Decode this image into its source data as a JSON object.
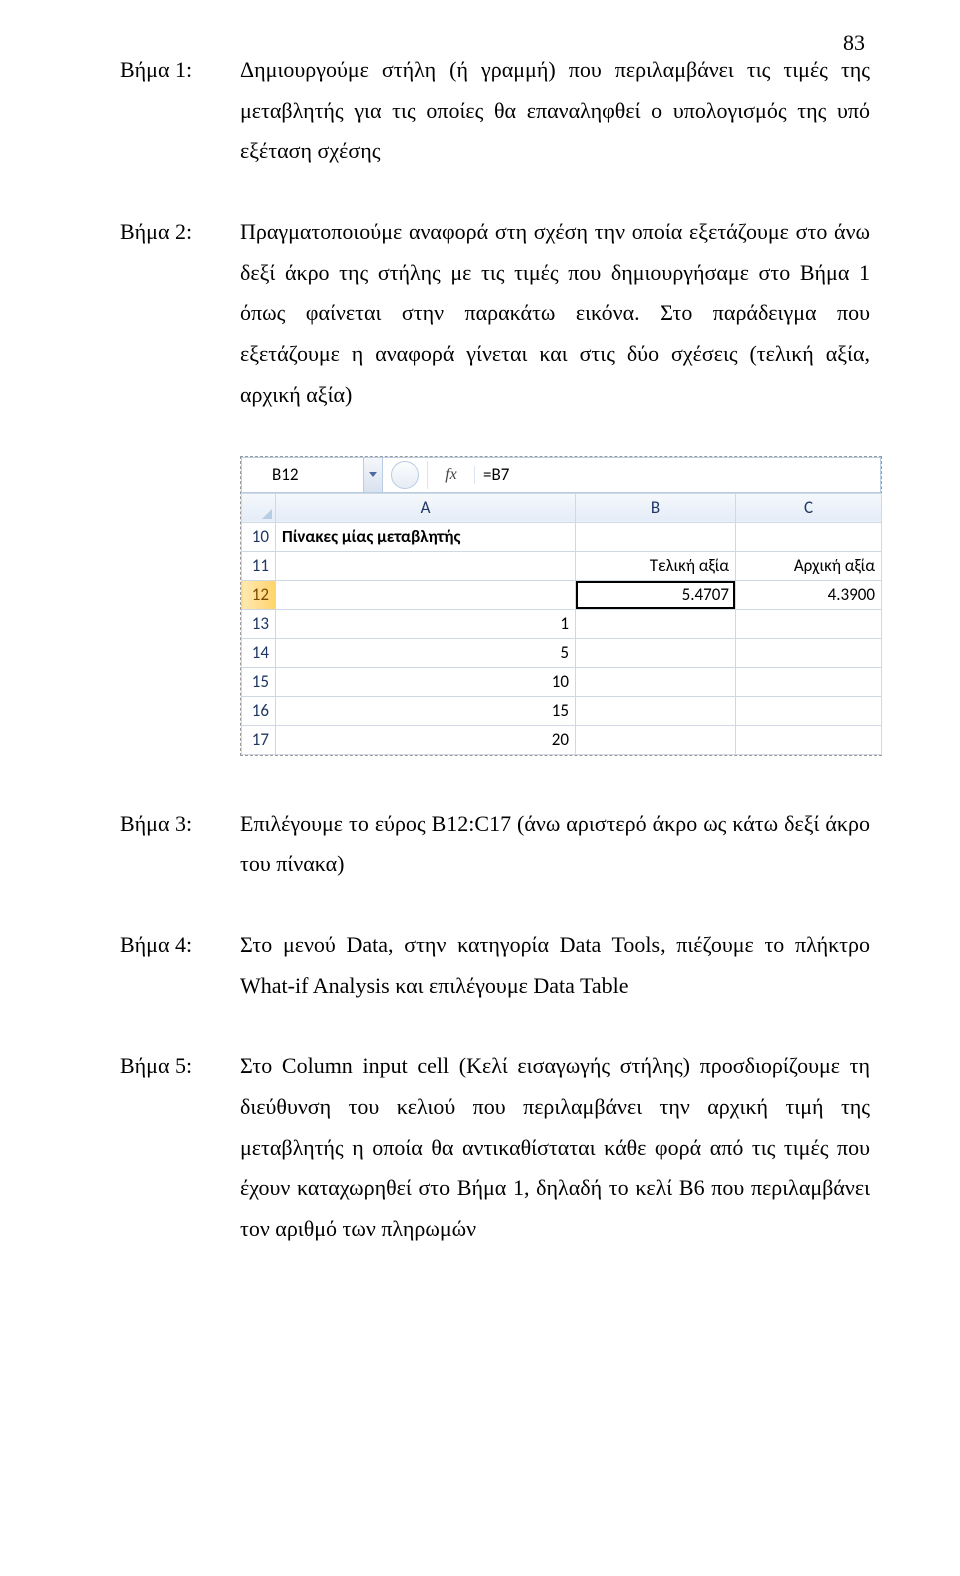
{
  "page_number": "83",
  "steps": {
    "s1": {
      "label": "Βήμα 1:",
      "text": "Δημιουργούμε στήλη (ή γραμμή) που περιλαμβάνει τις τιμές της μεταβλητής για τις οποίες θα επαναληφθεί ο υπολογισμός της υπό εξέταση σχέσης"
    },
    "s2": {
      "label": "Βήμα 2:",
      "text": "Πραγματοποιούμε αναφορά στη σχέση την οποία εξετάζουμε στο άνω δεξί άκρο της στήλης με τις τιμές που δημιουργήσαμε στο Βήμα 1 όπως φαίνεται στην παρακάτω εικόνα.   Στο παράδειγμα που εξετάζουμε η αναφορά γίνεται και στις δύο σχέσεις (τελική αξία, αρχική αξία)"
    },
    "s3": {
      "label": "Βήμα 3:",
      "text": "Επιλέγουμε το εύρος B12:C17 (άνω αριστερό άκρο ως κάτω δεξί άκρο του πίνακα)"
    },
    "s4": {
      "label": "Βήμα 4:",
      "text": "Στο μενού Data, στην κατηγορία Data Tools, πιέζουμε το πλήκτρο What-if Analysis και επιλέγουμε Data Table"
    },
    "s5": {
      "label": "Βήμα 5:",
      "text": "Στο Column input cell (Κελί εισαγωγής στήλης) προσδιορίζουμε τη διεύθυνση του κελιού που περιλαμβάνει την αρχική τιμή της μεταβλητής η οποία θα αντικαθίσταται κάθε φορά από τις τιμές που έχουν καταχωρηθεί στο Βήμα 1, δηλαδή το κελί B6 που περιλαμβάνει τον αριθμό των πληρωμών"
    }
  },
  "excel": {
    "namebox": "B12",
    "fx_label": "fx",
    "formula": "=B7",
    "columns": {
      "A": "A",
      "B": "B",
      "C": "C"
    },
    "rows": {
      "r10": {
        "num": "10",
        "A": "Πίνακες μίας μεταβλητής",
        "B": "",
        "C": ""
      },
      "r11": {
        "num": "11",
        "A": "",
        "B": "Τελική αξία",
        "C": "Αρχική αξία"
      },
      "r12": {
        "num": "12",
        "A": "",
        "B": "5.4707",
        "C": "4.3900"
      },
      "r13": {
        "num": "13",
        "A": "1",
        "B": "",
        "C": ""
      },
      "r14": {
        "num": "14",
        "A": "5",
        "B": "",
        "C": ""
      },
      "r15": {
        "num": "15",
        "A": "10",
        "B": "",
        "C": ""
      },
      "r16": {
        "num": "16",
        "A": "15",
        "B": "",
        "C": ""
      },
      "r17": {
        "num": "17",
        "A": "20",
        "B": "",
        "C": ""
      }
    }
  }
}
